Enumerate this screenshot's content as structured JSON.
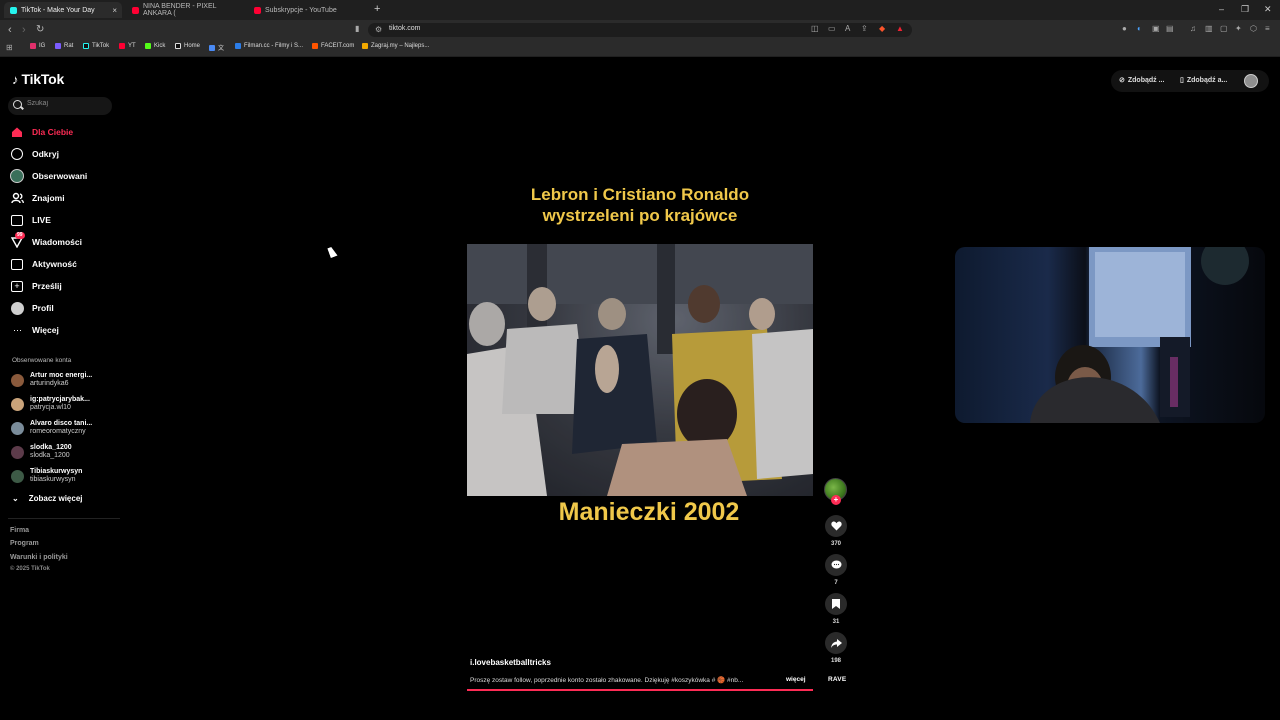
{
  "browser": {
    "tabs": [
      {
        "title": "TikTok - Make Your Day",
        "active": true,
        "close": "×"
      },
      {
        "title": "NINA BENDER - PIXEL ANKARA ("
      },
      {
        "title": "Subskrypcje - YouTube"
      }
    ],
    "new_tab": "+",
    "url": "tiktok.com",
    "bookmarks": [
      "IG",
      "Rat",
      "TikTok",
      "YT",
      "Kick",
      "Home",
      "文",
      "Filman.cc - Filmy i S...",
      "FACEIT.com",
      "Zagraj.my – Najleps..."
    ],
    "window_controls": [
      "–",
      "❐",
      "✕"
    ]
  },
  "tiktok": {
    "logo": "TikTok",
    "search_placeholder": "Szukaj",
    "nav": [
      {
        "label": "Dla Ciebie",
        "icon": "home-icon",
        "active": true
      },
      {
        "label": "Odkryj",
        "icon": "compass-icon"
      },
      {
        "label": "Obserwowani",
        "icon": "following-avatar-icon"
      },
      {
        "label": "Znajomi",
        "icon": "friends-icon"
      },
      {
        "label": "LIVE",
        "icon": "live-icon"
      },
      {
        "label": "Wiadomości",
        "icon": "messages-icon",
        "badge": "99"
      },
      {
        "label": "Aktywność",
        "icon": "activity-icon"
      },
      {
        "label": "Prześlij",
        "icon": "upload-icon"
      },
      {
        "label": "Profil",
        "icon": "profile-icon"
      },
      {
        "label": "Więcej",
        "icon": "more-icon"
      }
    ],
    "followed_title": "Obserwowane konta",
    "followed_accounts": [
      {
        "name": "Artur moc energi...",
        "handle": "arturindyka6"
      },
      {
        "name": "ig:patrycjarybak...",
        "handle": "patrycja.wl10"
      },
      {
        "name": "Alvaro disco tani...",
        "handle": "romeoromatyczny"
      },
      {
        "name": "slodka_1200",
        "handle": "slodka_1200"
      },
      {
        "name": "Tibiaskurwysyn",
        "handle": "tibiaskurwysyn"
      }
    ],
    "see_more": "Zobacz więcej",
    "footer_links": [
      "Firma",
      "Program",
      "Warunki i polityki"
    ],
    "copyright": "© 2025 TikTok",
    "top_right": {
      "btn1": "Zdobądź ...",
      "btn2": "Zdobądź a..."
    },
    "video": {
      "top_text_line1": "Lebron i Cristiano Ronaldo",
      "top_text_line2": "wystrzeleni po krajówce",
      "bottom_text": "Manieczki 2002",
      "author": "i.lovebasketballtricks",
      "caption": "Proszę zostaw follow, poprzednie konto zostało zhakowane. Dziękuję #koszykówka # 🏀 #nb...",
      "more": "więcej",
      "progress": 1.0
    },
    "actions": {
      "likes": "370",
      "comments": "7",
      "saves": "31",
      "shares": "198"
    },
    "music": "RAVE"
  }
}
